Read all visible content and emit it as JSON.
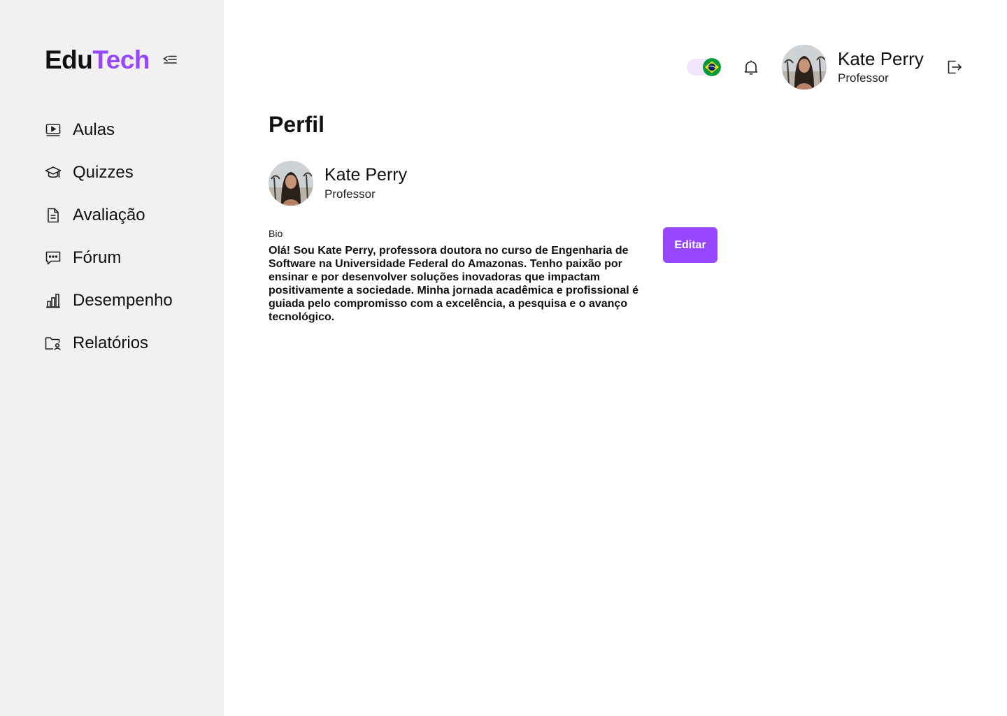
{
  "brand": {
    "part1": "Edu",
    "part2": "Tech",
    "accent_color": "#9747ff"
  },
  "sidebar": {
    "items": [
      {
        "label": "Aulas",
        "icon": "video-lesson-icon"
      },
      {
        "label": "Quizzes",
        "icon": "graduation-cap-icon"
      },
      {
        "label": "Avaliação",
        "icon": "document-icon"
      },
      {
        "label": "Fórum",
        "icon": "chat-icon"
      },
      {
        "label": "Desempenho",
        "icon": "bar-chart-icon"
      },
      {
        "label": "Relatórios",
        "icon": "folder-user-icon"
      }
    ]
  },
  "header": {
    "language_flag": "brazil-flag-icon",
    "user": {
      "name": "Kate Perry",
      "role": "Professor"
    }
  },
  "main": {
    "title": "Perfil",
    "profile": {
      "name": "Kate Perry",
      "role": "Professor"
    },
    "bio_label": "Bio",
    "bio_text": "Olá! Sou Kate Perry, professora doutora no curso de Engenharia de Software na Universidade Federal do Amazonas. Tenho paixão por ensinar e por desenvolver soluções inovadoras que impactam positivamente a sociedade. Minha jornada acadêmica e profissional é guiada pelo compromisso com a excelência, a pesquisa e o avanço tecnológico.",
    "edit_label": "Editar"
  }
}
